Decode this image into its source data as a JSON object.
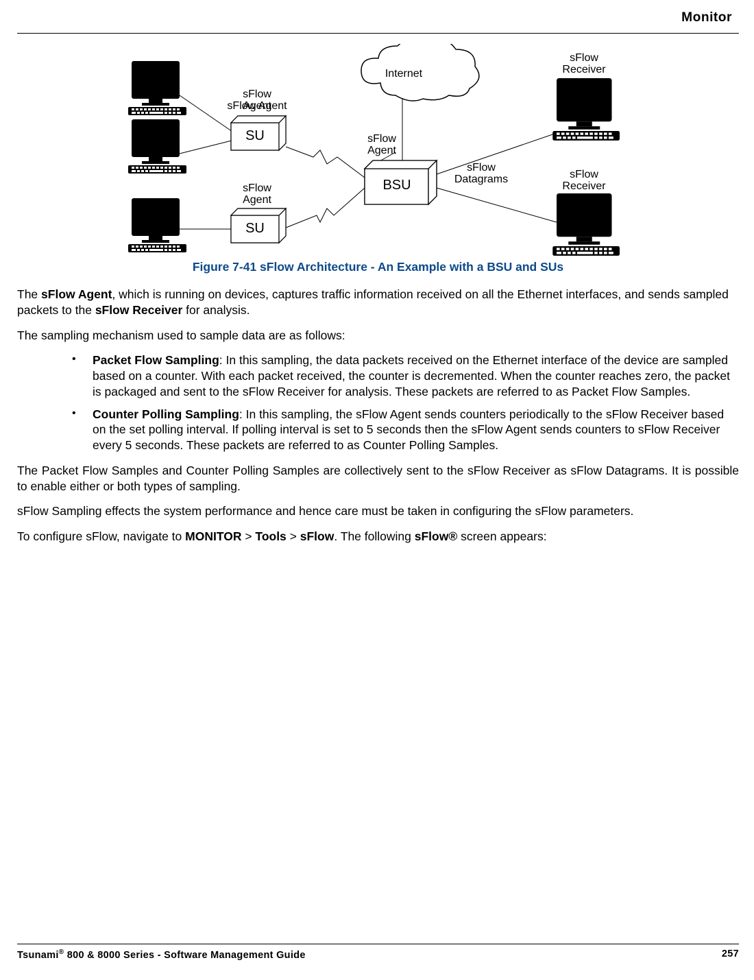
{
  "header": {
    "title": "Monitor"
  },
  "figure": {
    "caption": "Figure 7-41 sFlow Architecture - An Example with a BSU and SUs",
    "labels": {
      "internet": "Internet",
      "sflow_agent": "sFlow\nAgent",
      "sflow_receiver": "sFlow\nReceiver",
      "sflow_datagrams": "sFlow\nDatagrams",
      "su": "SU",
      "bsu": "BSU"
    }
  },
  "paragraphs": {
    "p1_a": "The ",
    "p1_b": "sFlow Agent",
    "p1_c": ", which is running on devices, captures traffic information received on all the Ethernet interfaces, and sends sampled packets to the ",
    "p1_d": "sFlow Receiver",
    "p1_e": " for analysis.",
    "p2": "The sampling mechanism used to sample data are as follows:",
    "b1_a": "Packet Flow Sampling",
    "b1_b": ": In this sampling, the data packets received on the Ethernet interface of the device are sampled based on a counter. With each packet received, the counter is decremented. When the counter reaches zero, the packet is packaged and sent to the sFlow Receiver for analysis. These packets are referred to as Packet Flow Samples.",
    "b2_a": "Counter Polling Sampling",
    "b2_b": ": In this sampling, the sFlow Agent sends counters periodically to the sFlow Receiver based on the set polling interval. If polling interval is set to 5 seconds then the sFlow Agent sends counters to sFlow Receiver every 5 seconds. These packets are referred to as Counter Polling Samples.",
    "p3": "The Packet Flow Samples and Counter Polling Samples are collectively sent to the sFlow Receiver as sFlow Datagrams. It is possible to enable either or both types of sampling.",
    "p4": "sFlow Sampling effects the system performance and hence care must be taken in configuring the sFlow parameters.",
    "p5_a": "To configure sFlow, navigate to ",
    "p5_b": "MONITOR",
    "p5_c": " > ",
    "p5_d": "Tools",
    "p5_e": " > ",
    "p5_f": "sFlow",
    "p5_g": ". The following ",
    "p5_h": "sFlow®",
    "p5_i": " screen appears:"
  },
  "footer": {
    "left_a": "Tsunami",
    "left_b": "®",
    "left_c": " 800 & 8000 Series - Software Management Guide",
    "page": "257"
  }
}
